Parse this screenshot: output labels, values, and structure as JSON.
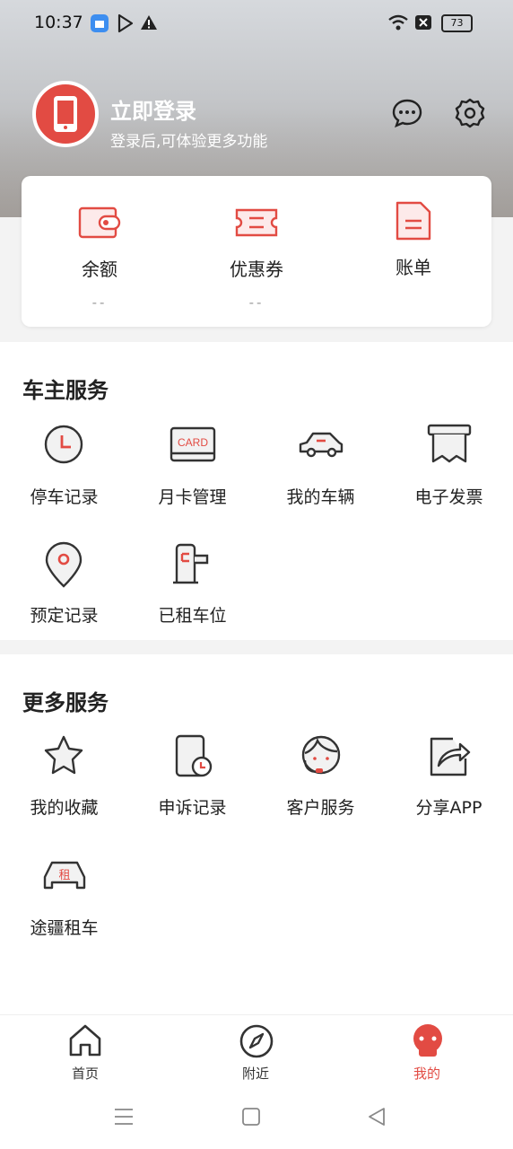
{
  "status_bar": {
    "time": "10:37",
    "battery": "73"
  },
  "header": {
    "login_title": "立即登录",
    "login_subtitle": "登录后,可体验更多功能"
  },
  "account": [
    {
      "label": "余额",
      "value": "--",
      "icon": "wallet-icon"
    },
    {
      "label": "优惠券",
      "value": "--",
      "icon": "coupon-icon"
    },
    {
      "label": "账单",
      "value": "",
      "icon": "bill-icon"
    }
  ],
  "owner_services": {
    "title": "车主服务",
    "items": [
      {
        "label": "停车记录",
        "icon": "clock-icon"
      },
      {
        "label": "月卡管理",
        "icon": "card-icon",
        "card_text": "CARD"
      },
      {
        "label": "我的车辆",
        "icon": "car-icon"
      },
      {
        "label": "电子发票",
        "icon": "invoice-icon"
      },
      {
        "label": "预定记录",
        "icon": "location-pin-icon"
      },
      {
        "label": "已租车位",
        "icon": "parking-gate-icon"
      }
    ]
  },
  "more_services": {
    "title": "更多服务",
    "items": [
      {
        "label": "我的收藏",
        "icon": "star-icon"
      },
      {
        "label": "申诉记录",
        "icon": "appeal-icon"
      },
      {
        "label": "客户服务",
        "icon": "customer-service-icon"
      },
      {
        "label": "分享APP",
        "icon": "share-icon"
      },
      {
        "label": "途疆租车",
        "icon": "rent-car-icon",
        "badge_text": "租"
      }
    ]
  },
  "tabbar": [
    {
      "label": "首页",
      "icon": "home-icon",
      "active": false
    },
    {
      "label": "附近",
      "icon": "compass-icon",
      "active": false
    },
    {
      "label": "我的",
      "icon": "profile-icon",
      "active": true
    }
  ],
  "colors": {
    "accent": "#e24b43",
    "text": "#222222",
    "muted": "#999999"
  }
}
